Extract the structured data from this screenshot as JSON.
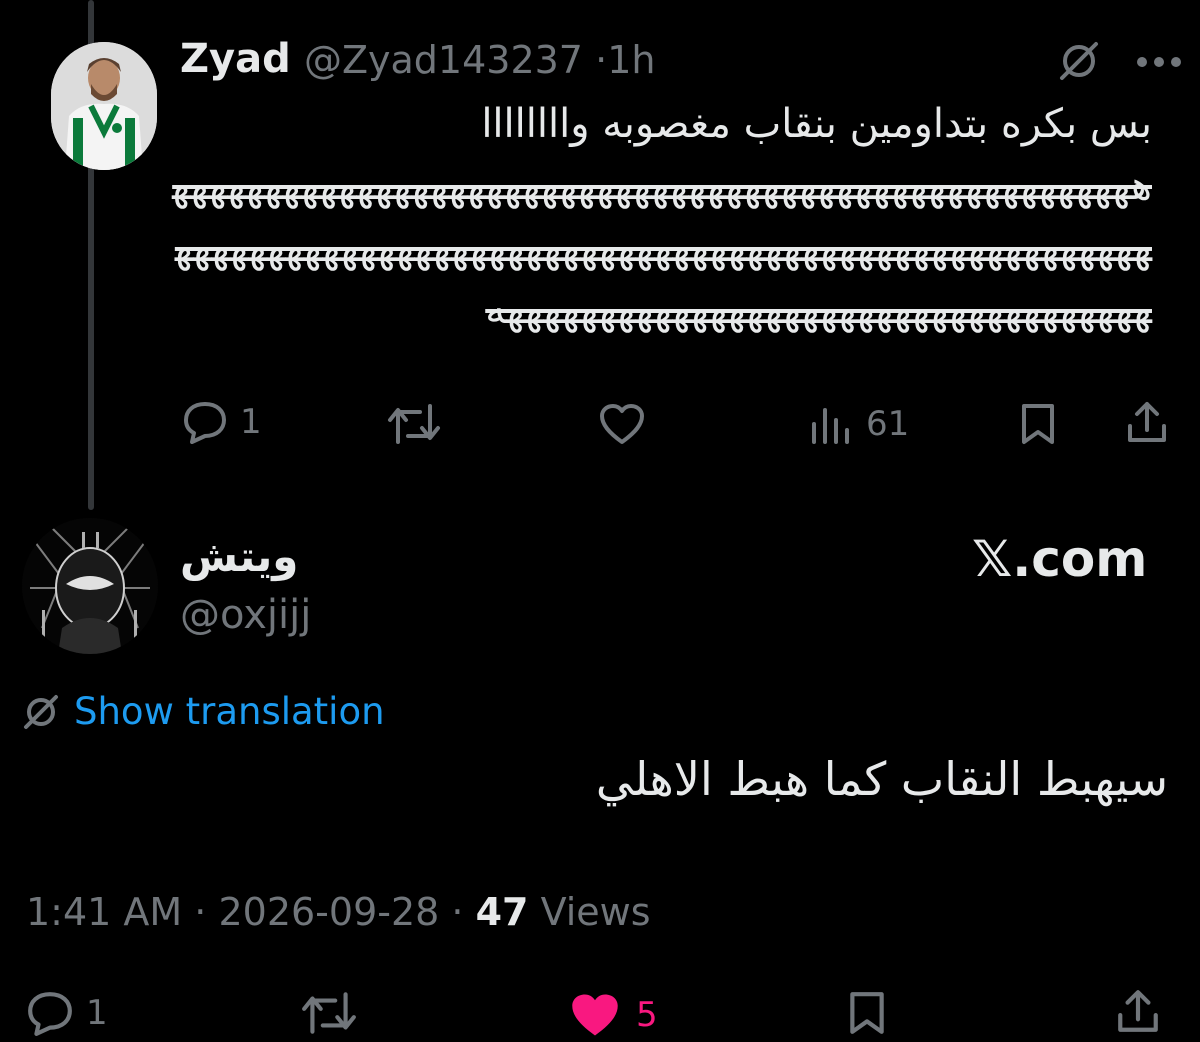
{
  "tweet": {
    "author_name": "Zyad",
    "author_handle": "@Zyad143237",
    "separator": "·",
    "time_ago": "1h",
    "text_line1": "بس بكره بتداومين بنقاب مغصوبه واااااااا",
    "text_laugh": "هههههههههههههههههههههههههههههههههههههههههههههههههههههههههههههههههههههههههههههههههههههههههههههههههههههههههههههههههههههههههههههههههههههههههههههه",
    "replies": "1",
    "views": "61",
    "icons": [
      "no-translate-icon",
      "more-icon",
      "reply-icon",
      "retweet-icon",
      "like-icon",
      "views-icon",
      "bookmark-icon",
      "share-icon"
    ]
  },
  "reply": {
    "author_name": "ويتش",
    "author_handle": "@oxjijj",
    "watermark": "𝕏.com",
    "show_translation": "Show translation",
    "text": "سيهبط النقاب كما هبط الاهلي",
    "time": "1:41 AM",
    "date": "2026-09-28",
    "views_count": "47",
    "views_label": "Views",
    "replies": "1",
    "likes": "5",
    "like_color": "#f91880",
    "link_color": "#1d9bf0"
  }
}
